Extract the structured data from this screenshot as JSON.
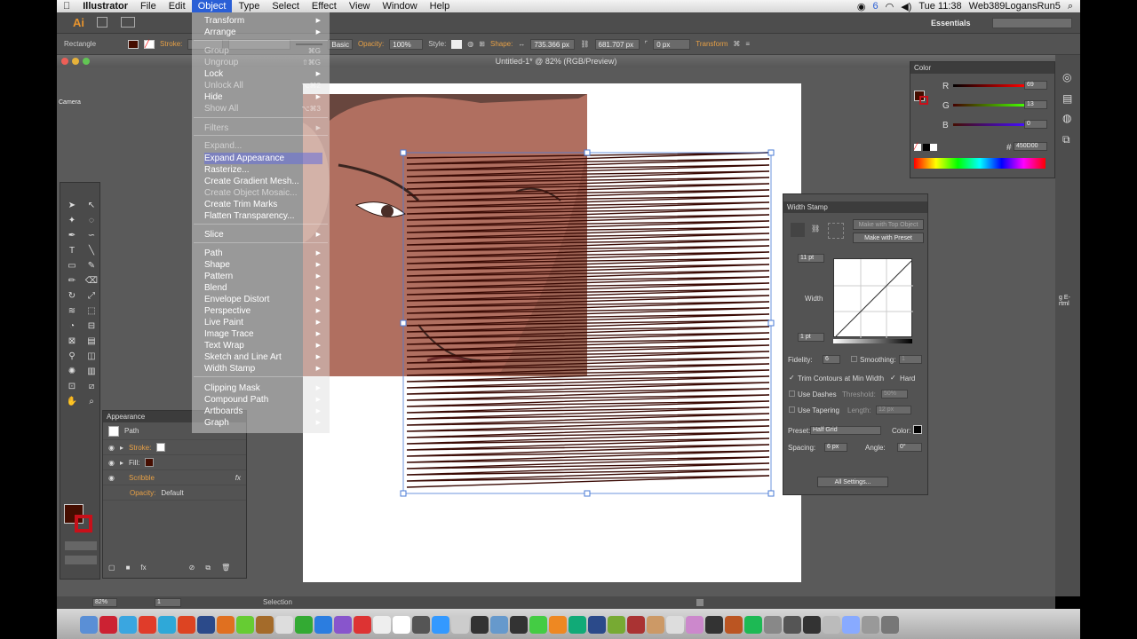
{
  "menubar": {
    "app": "Illustrator",
    "items": [
      "File",
      "Edit",
      "Object",
      "Type",
      "Select",
      "Effect",
      "View",
      "Window",
      "Help"
    ],
    "active": "Object",
    "clock": "Tue 11:38",
    "user": "Web389LogansRun5",
    "badge": "6"
  },
  "appbar": {
    "logo": "Ai",
    "workspace": "Essentials"
  },
  "control": {
    "tool": "Rectangle",
    "stroke_label": "Stroke:",
    "brush": "Basic",
    "opacity_label": "Opacity:",
    "opacity": "100%",
    "style_label": "Style:",
    "shape_label": "Shape:",
    "width": "735.366 px",
    "height": "681.707 px",
    "corner": "0 px",
    "transform": "Transform"
  },
  "document": {
    "title": "Untitled-1* @ 82% (RGB/Preview)",
    "left_label": "Camera"
  },
  "object_menu": {
    "items": [
      {
        "label": "Transform",
        "state": "normal",
        "arrow": true
      },
      {
        "label": "Arrange",
        "state": "normal",
        "arrow": true
      },
      {
        "label": "Group",
        "state": "dis",
        "shortcut": "⌘G"
      },
      {
        "label": "Ungroup",
        "state": "dis",
        "shortcut": "⇧⌘G"
      },
      {
        "label": "Lock",
        "state": "normal",
        "arrow": true
      },
      {
        "label": "Unlock All",
        "state": "dis",
        "shortcut": "⌥⌘2"
      },
      {
        "label": "Hide",
        "state": "normal",
        "arrow": true
      },
      {
        "label": "Show All",
        "state": "dis",
        "shortcut": "⌥⌘3"
      },
      {
        "label": "Filters",
        "state": "dis",
        "arrow": true
      },
      {
        "label": "Expand...",
        "state": "dis"
      },
      {
        "label": "Expand Appearance",
        "state": "hl"
      },
      {
        "label": "Rasterize...",
        "state": "normal"
      },
      {
        "label": "Create Gradient Mesh...",
        "state": "normal"
      },
      {
        "label": "Create Object Mosaic...",
        "state": "dis"
      },
      {
        "label": "Create Trim Marks",
        "state": "normal"
      },
      {
        "label": "Flatten Transparency...",
        "state": "normal"
      },
      {
        "label": "Slice",
        "state": "normal",
        "arrow": true
      },
      {
        "label": "Path",
        "state": "normal",
        "arrow": true
      },
      {
        "label": "Shape",
        "state": "normal",
        "arrow": true
      },
      {
        "label": "Pattern",
        "state": "normal",
        "arrow": true
      },
      {
        "label": "Blend",
        "state": "normal",
        "arrow": true
      },
      {
        "label": "Envelope Distort",
        "state": "normal",
        "arrow": true
      },
      {
        "label": "Perspective",
        "state": "normal",
        "arrow": true
      },
      {
        "label": "Live Paint",
        "state": "normal",
        "arrow": true
      },
      {
        "label": "Image Trace",
        "state": "normal",
        "arrow": true
      },
      {
        "label": "Text Wrap",
        "state": "normal",
        "arrow": true
      },
      {
        "label": "Sketch and Line Art",
        "state": "normal",
        "arrow": true
      },
      {
        "label": "Width Stamp",
        "state": "normal",
        "arrow": true
      },
      {
        "label": "Clipping Mask",
        "state": "normal",
        "arrow": true
      },
      {
        "label": "Compound Path",
        "state": "normal",
        "arrow": true
      },
      {
        "label": "Artboards",
        "state": "normal",
        "arrow": true
      },
      {
        "label": "Graph",
        "state": "normal",
        "arrow": true
      }
    ]
  },
  "appearance": {
    "title": "Appearance",
    "path": "Path",
    "stroke": "Stroke:",
    "fill": "Fill:",
    "effect": "Scribble",
    "opacity_label": "Opacity:",
    "opacity_value": "Default",
    "fx": "fx"
  },
  "color": {
    "title": "Color",
    "r_label": "R",
    "g_label": "G",
    "b_label": "B",
    "r": "69",
    "g": "13",
    "b": "0",
    "hex": "450D00",
    "swatch": "#450D00"
  },
  "width_stamp": {
    "title": "Width Stamp",
    "btn_top": "Make with Top Object",
    "btn_preset": "Make with Preset",
    "max": "11 pt",
    "width_label": "Width",
    "min": "1 pt",
    "fidelity_label": "Fidelity:",
    "fidelity": "6",
    "smoothing_label": "Smoothing:",
    "smoothing": "1",
    "trim": "Trim Contours at Min Width",
    "hard": "Hard",
    "dashes": "Use Dashes",
    "threshold_label": "Threshold:",
    "threshold": "50%",
    "tapering": "Use Tapering",
    "length_label": "Length:",
    "length": "12 px",
    "preset_label": "Preset:",
    "preset": "Half Grid",
    "color_label": "Color:",
    "spacing_label": "Spacing:",
    "spacing": "6 px",
    "angle_label": "Angle:",
    "angle": "0°",
    "all_settings": "All Settings..."
  },
  "status": {
    "zoom": "82%",
    "page": "1",
    "tool": "Selection"
  },
  "right_strip": {
    "text": "g E-\nrtml"
  }
}
